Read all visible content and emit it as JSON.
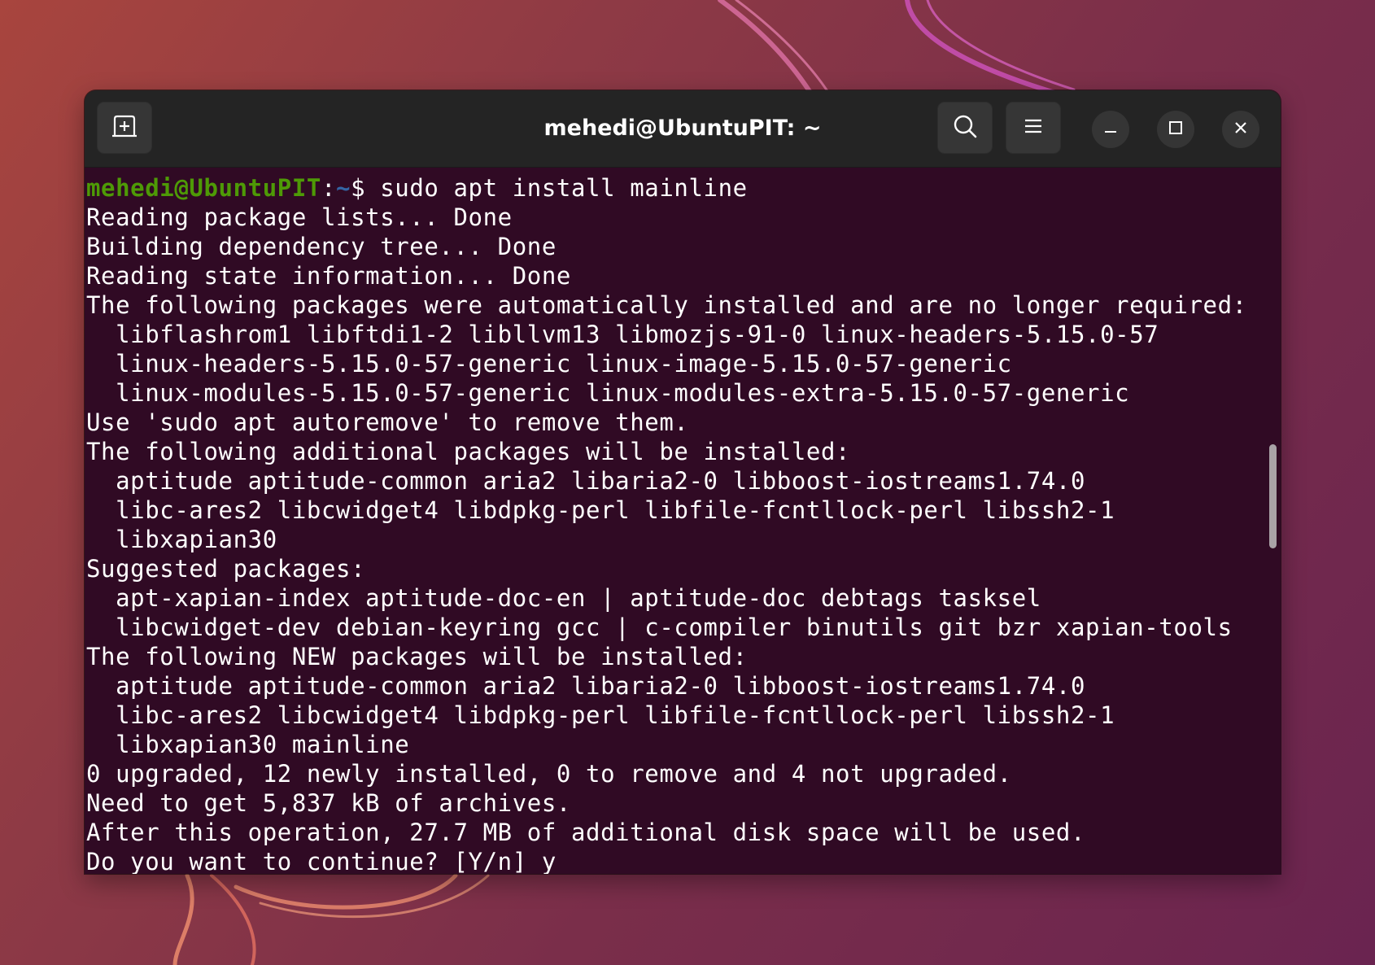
{
  "window": {
    "title": "mehedi@UbuntuPIT: ~"
  },
  "titlebar": {
    "new_tab_icon": "new-tab-icon",
    "search_icon": "search-icon",
    "menu_icon": "hamburger-menu-icon",
    "minimize_icon": "minimize-icon",
    "maximize_icon": "maximize-icon",
    "close_icon": "close-icon"
  },
  "prompt": {
    "user_host": "mehedi@UbuntuPIT",
    "separator": ":",
    "path": "~",
    "symbol": "$ ",
    "command": "sudo apt install mainline"
  },
  "output": [
    "Reading package lists... Done",
    "Building dependency tree... Done",
    "Reading state information... Done",
    "The following packages were automatically installed and are no longer required:",
    "  libflashrom1 libftdi1-2 libllvm13 libmozjs-91-0 linux-headers-5.15.0-57",
    "  linux-headers-5.15.0-57-generic linux-image-5.15.0-57-generic",
    "  linux-modules-5.15.0-57-generic linux-modules-extra-5.15.0-57-generic",
    "Use 'sudo apt autoremove' to remove them.",
    "The following additional packages will be installed:",
    "  aptitude aptitude-common aria2 libaria2-0 libboost-iostreams1.74.0",
    "  libc-ares2 libcwidget4 libdpkg-perl libfile-fcntllock-perl libssh2-1",
    "  libxapian30",
    "Suggested packages:",
    "  apt-xapian-index aptitude-doc-en | aptitude-doc debtags tasksel",
    "  libcwidget-dev debian-keyring gcc | c-compiler binutils git bzr xapian-tools",
    "The following NEW packages will be installed:",
    "  aptitude aptitude-common aria2 libaria2-0 libboost-iostreams1.74.0",
    "  libc-ares2 libcwidget4 libdpkg-perl libfile-fcntllock-perl libssh2-1",
    "  libxapian30 mainline",
    "0 upgraded, 12 newly installed, 0 to remove and 4 not upgraded.",
    "Need to get 5,837 kB of archives.",
    "After this operation, 27.7 MB of additional disk space will be used.",
    "Do you want to continue? [Y/n] y"
  ],
  "colors": {
    "terminal_bg": "#300a24",
    "titlebar_bg": "#242424",
    "prompt_user": "#4e9a06",
    "prompt_path": "#3465a4",
    "text": "#ffffff"
  }
}
